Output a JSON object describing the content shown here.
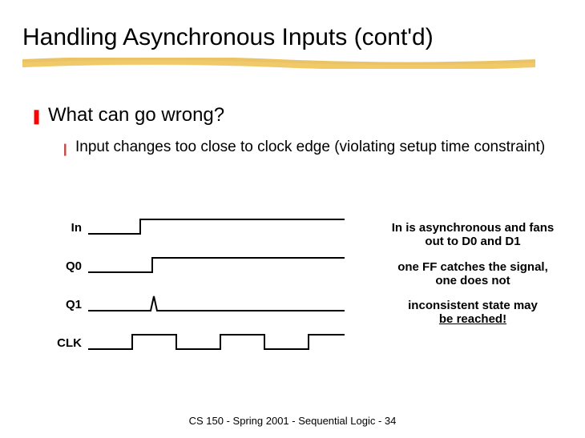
{
  "title": "Handling Asynchronous Inputs (cont'd)",
  "main_bullet": "What can go wrong?",
  "sub_bullet": "Input changes too close to clock edge (violating setup time constraint)",
  "signals": {
    "in": "In",
    "q0": "Q0",
    "q1": "Q1",
    "clk": "CLK"
  },
  "annotations": {
    "a1": "In is asynchronous and fans out to D0 and D1",
    "a2": "one FF catches the signal, one does not",
    "a3_top": "inconsistent state may",
    "a3_bot": "be reached!"
  },
  "footer": "CS 150 - Spring  2001 - Sequential Logic - 34"
}
